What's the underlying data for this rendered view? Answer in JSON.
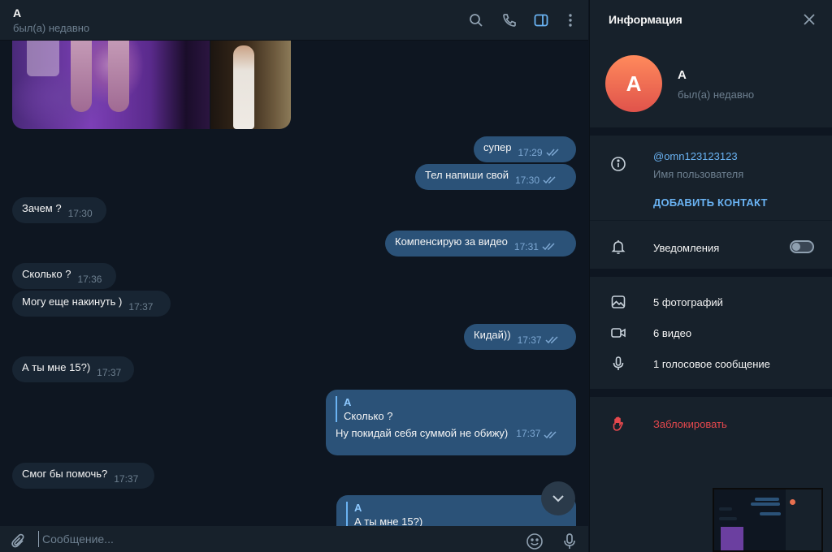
{
  "chat": {
    "title": "A",
    "status": "был(а) недавно",
    "header_icons": [
      "search-icon",
      "phone-icon",
      "sidebar-toggle-icon",
      "more-vertical-icon"
    ]
  },
  "messages": [
    {
      "dir": "out",
      "text": "супер",
      "time": "17:29"
    },
    {
      "dir": "out",
      "text": "Тел напиши свой",
      "time": "17:30"
    },
    {
      "dir": "in",
      "text": "Зачем ?",
      "time": "17:30"
    },
    {
      "dir": "out",
      "text": "Компенсирую за видео",
      "time": "17:31"
    },
    {
      "dir": "in",
      "text": "Сколько ?",
      "time": "17:36"
    },
    {
      "dir": "in",
      "text": "Могу еще накинуть )",
      "time": "17:37"
    },
    {
      "dir": "out",
      "text": "Кидай))",
      "time": "17:37"
    },
    {
      "dir": "in",
      "text": "А ты мне 15?)",
      "time": "17:37"
    },
    {
      "dir": "out",
      "reply_name": "A",
      "reply_text": "Сколько ?",
      "text": "Ну покидай себя суммой не обижу)",
      "time": "17:37"
    },
    {
      "dir": "in",
      "text": "Смог бы помочь?",
      "time": "17:37"
    },
    {
      "dir": "out",
      "reply_name": "A",
      "reply_text": "А ты мне 15?)"
    }
  ],
  "composer": {
    "placeholder": "Сообщение..."
  },
  "info": {
    "title": "Информация",
    "avatar_letter": "A",
    "name": "A",
    "status": "был(а) недавно",
    "username": "@omn123123123",
    "username_label": "Имя пользователя",
    "add_contact": "ДОБАВИТЬ КОНТАКТ",
    "notifications": "Уведомления",
    "notifications_on": false,
    "photos": "5 фотографий",
    "videos": "6 видео",
    "voice": "1 голосовое сообщение",
    "block": "Заблокировать"
  },
  "colors": {
    "bg": "#0e1621",
    "panel": "#17212b",
    "bubble_in": "#182533",
    "bubble_out": "#2b5278",
    "accent": "#6ab3f3",
    "danger": "#e5484d",
    "avatar": "#e8704f"
  }
}
